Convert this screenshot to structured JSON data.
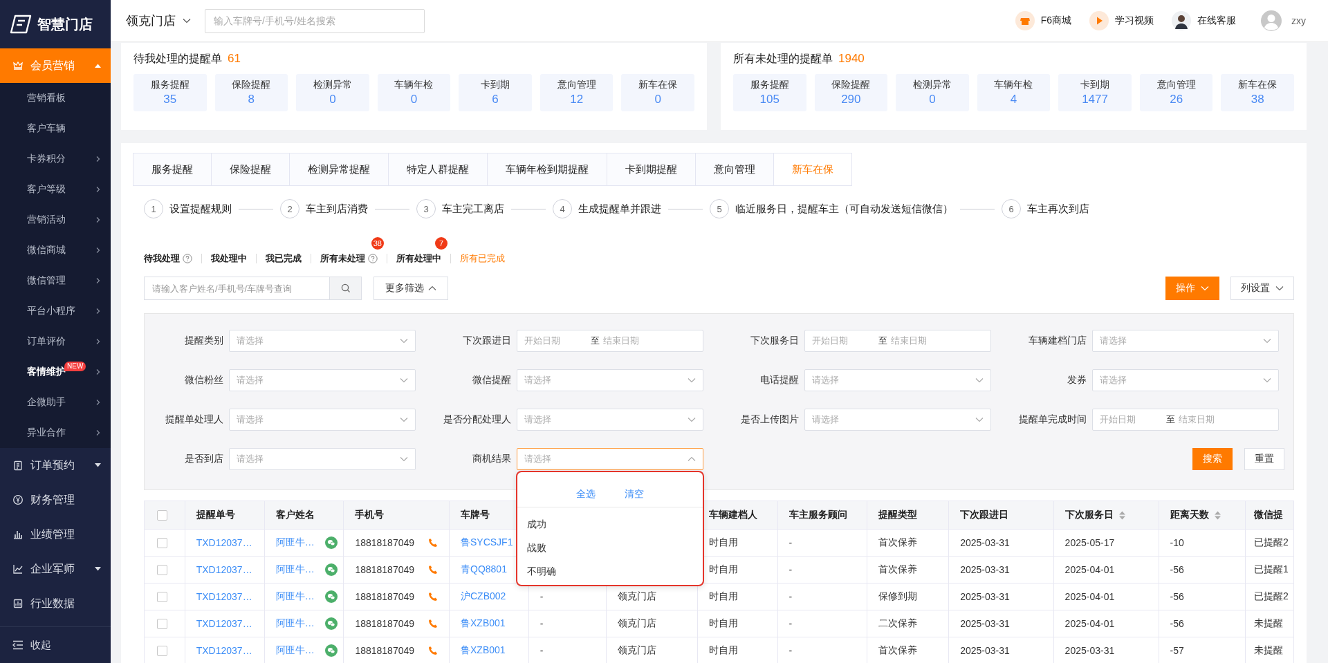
{
  "sidebar": {
    "logo": "智慧门店",
    "collapse": "收起",
    "groups": [
      {
        "label": "会员营销",
        "kind": "submenu",
        "expanded": true,
        "selected": true,
        "items": [
          {
            "label": "营销看板",
            "kind": "link",
            "selected": false
          },
          {
            "label": "客户车辆",
            "kind": "link",
            "selected": false
          },
          {
            "label": "卡券积分",
            "kind": "submenu",
            "selected": false
          },
          {
            "label": "客户等级",
            "kind": "submenu",
            "selected": false
          },
          {
            "label": "营销活动",
            "kind": "submenu",
            "selected": false
          },
          {
            "label": "微信商城",
            "kind": "submenu",
            "selected": false
          },
          {
            "label": "微信管理",
            "kind": "submenu",
            "selected": false
          },
          {
            "label": "平台小程序",
            "kind": "submenu",
            "selected": false
          },
          {
            "label": "订单评价",
            "kind": "submenu",
            "selected": false
          },
          {
            "label": "客情维护",
            "kind": "submenu",
            "selected": true,
            "badge": "NEW"
          },
          {
            "label": "企微助手",
            "kind": "submenu",
            "selected": false
          },
          {
            "label": "异业合作",
            "kind": "submenu",
            "selected": false
          }
        ]
      },
      {
        "label": "订单预约",
        "kind": "submenu",
        "expanded": false,
        "selected": false
      },
      {
        "label": "财务管理",
        "kind": "link",
        "selected": false
      },
      {
        "label": "业绩管理",
        "kind": "link",
        "selected": false
      },
      {
        "label": "企业军师",
        "kind": "submenu",
        "expanded": false,
        "selected": false
      },
      {
        "label": "行业数据",
        "kind": "link",
        "selected": false
      }
    ]
  },
  "header": {
    "store": "领克门店",
    "search_placeholder": "输入车牌号/手机号/姓名搜索",
    "user": "zxy",
    "links": [
      {
        "label": "F6商城",
        "kind": "shop"
      },
      {
        "label": "学习视频",
        "kind": "video"
      },
      {
        "label": "在线客服",
        "kind": "service"
      }
    ]
  },
  "stat_panels": [
    {
      "title": "待我处理的提醒单",
      "count": "61",
      "items": [
        {
          "label": "服务提醒",
          "value": "35"
        },
        {
          "label": "保险提醒",
          "value": "8"
        },
        {
          "label": "检测异常",
          "value": "0"
        },
        {
          "label": "车辆年检",
          "value": "0"
        },
        {
          "label": "卡到期",
          "value": "6"
        },
        {
          "label": "意向管理",
          "value": "12"
        },
        {
          "label": "新车在保",
          "value": "0"
        }
      ]
    },
    {
      "title": "所有未处理的提醒单",
      "count": "1940",
      "items": [
        {
          "label": "服务提醒",
          "value": "105"
        },
        {
          "label": "保险提醒",
          "value": "290"
        },
        {
          "label": "检测异常",
          "value": "0"
        },
        {
          "label": "车辆年检",
          "value": "4"
        },
        {
          "label": "卡到期",
          "value": "1477"
        },
        {
          "label": "意向管理",
          "value": "26"
        },
        {
          "label": "新车在保",
          "value": "38"
        }
      ]
    }
  ],
  "tabs": [
    {
      "label": "服务提醒",
      "selected": false
    },
    {
      "label": "保险提醒",
      "selected": false
    },
    {
      "label": "检测异常提醒",
      "selected": false
    },
    {
      "label": "特定人群提醒",
      "selected": false
    },
    {
      "label": "车辆年检到期提醒",
      "selected": false
    },
    {
      "label": "卡到期提醒",
      "selected": false
    },
    {
      "label": "意向管理",
      "selected": false
    },
    {
      "label": "新车在保",
      "selected": true
    }
  ],
  "steps": [
    {
      "number": "1",
      "label": "设置提醒规则"
    },
    {
      "number": "2",
      "label": "车主到店消费"
    },
    {
      "number": "3",
      "label": "车主完工离店"
    },
    {
      "number": "4",
      "label": "生成提醒单并跟进"
    },
    {
      "number": "5",
      "label": "临近服务日，提醒车主（可自动发送短信微信）"
    },
    {
      "number": "6",
      "label": "车主再次到店"
    }
  ],
  "status_tabs": [
    {
      "label": "待我处理",
      "selected": false,
      "help": true
    },
    {
      "label": "我处理中",
      "selected": false,
      "help": false
    },
    {
      "label": "我已完成",
      "selected": false,
      "help": false
    },
    {
      "label": "所有未处理",
      "selected": false,
      "help": true,
      "badge": "38"
    },
    {
      "label": "所有处理中",
      "selected": false,
      "help": false,
      "badge": "7"
    },
    {
      "label": "所有已完成",
      "selected": true,
      "help": false
    }
  ],
  "search": {
    "placeholder": "请输入客户姓名/手机号/车牌号查询"
  },
  "more_filters": {
    "label": "更多筛选",
    "expanded": true
  },
  "actions": [
    {
      "label": "操作",
      "kind": "primary"
    },
    {
      "label": "列设置",
      "kind": "default"
    }
  ],
  "filters": [
    {
      "label": "提醒类别",
      "kind": "select",
      "placeholder": "请选择",
      "open": false
    },
    {
      "label": "下次跟进日",
      "kind": "date",
      "start": "开始日期",
      "separator": "至",
      "end": "结束日期"
    },
    {
      "label": "下次服务日",
      "kind": "date",
      "start": "开始日期",
      "separator": "至",
      "end": "结束日期"
    },
    {
      "label": "车辆建档门店",
      "kind": "select",
      "placeholder": "请选择",
      "open": false
    },
    {
      "label": "微信粉丝",
      "kind": "select",
      "placeholder": "请选择",
      "open": false
    },
    {
      "label": "微信提醒",
      "kind": "select",
      "placeholder": "请选择",
      "open": false
    },
    {
      "label": "电话提醒",
      "kind": "select",
      "placeholder": "请选择",
      "open": false
    },
    {
      "label": "发券",
      "kind": "select",
      "placeholder": "请选择",
      "open": false
    },
    {
      "label": "提醒单处理人",
      "kind": "select",
      "placeholder": "请选择",
      "open": false
    },
    {
      "label": "是否分配处理人",
      "kind": "select",
      "placeholder": "请选择",
      "open": false
    },
    {
      "label": "是否上传图片",
      "kind": "select",
      "placeholder": "请选择",
      "open": false
    },
    {
      "label": "提醒单完成时间",
      "kind": "date",
      "start": "开始日期",
      "separator": "至",
      "end": "结束日期"
    },
    {
      "label": "是否到店",
      "kind": "select",
      "placeholder": "请选择",
      "open": false
    },
    {
      "label": "商机结果",
      "kind": "select",
      "placeholder": "请选择",
      "open": true,
      "menu": {
        "actions": [
          "全选",
          "清空"
        ],
        "options": [
          "成功",
          "战败",
          "不明确"
        ]
      }
    }
  ],
  "filter_buttons": [
    {
      "label": "搜索",
      "kind": "primary"
    },
    {
      "label": "重置",
      "kind": "default"
    }
  ],
  "table": {
    "select_all": {
      "checked": false
    },
    "columns": [
      {
        "label": "提醒单号",
        "kind": "link",
        "sortable": false
      },
      {
        "label": "客户姓名",
        "kind": "wechat-link",
        "sortable": false
      },
      {
        "label": "手机号",
        "kind": "phone",
        "sortable": false
      },
      {
        "label": "车牌号",
        "kind": "link",
        "sortable": false
      },
      {
        "kind": "text"
      },
      {
        "kind": "text"
      },
      {
        "label": "车辆建档人",
        "kind": "text",
        "sortable": false
      },
      {
        "label": "车主服务顾问",
        "kind": "text",
        "sortable": false
      },
      {
        "label": "提醒类型",
        "kind": "text",
        "sortable": false
      },
      {
        "label": "下次跟进日",
        "kind": "text",
        "sortable": false
      },
      {
        "label": "下次服务日",
        "kind": "text",
        "sortable": true
      },
      {
        "label": "距离天数",
        "kind": "text",
        "sortable": true
      },
      {
        "label": "微信提",
        "kind": "text",
        "sortable": false
      }
    ],
    "rows": [
      {
        "checked": false,
        "cells": [
          "TXD12037…",
          "阿匪牛…",
          "18818187049",
          "鲁SYCSJF1",
          null,
          null,
          "时自用",
          "-",
          "首次保养",
          "2025-03-31",
          "2025-05-17",
          "-10",
          "已提醒2"
        ]
      },
      {
        "checked": false,
        "cells": [
          "TXD12037…",
          "阿匪牛…",
          "18818187049",
          "青QQ8801",
          null,
          null,
          "时自用",
          "-",
          "首次保养",
          "2025-03-31",
          "2025-04-01",
          "-56",
          "已提醒1"
        ]
      },
      {
        "checked": false,
        "cells": [
          "TXD12037…",
          "阿匪牛…",
          "18818187049",
          "沪CZB002",
          "-",
          "领克门店",
          "时自用",
          "-",
          "保修到期",
          "2025-03-31",
          "2025-04-01",
          "-56",
          "已提醒2"
        ]
      },
      {
        "checked": false,
        "cells": [
          "TXD12037…",
          "阿匪牛…",
          "18818187049",
          "鲁XZB001",
          "-",
          "领克门店",
          "时自用",
          "-",
          "二次保养",
          "2025-03-31",
          "2025-04-01",
          "-56",
          "未提醒"
        ]
      },
      {
        "checked": false,
        "cells": [
          "TXD12037…",
          "阿匪牛…",
          "18818187049",
          "鲁XZB001",
          "-",
          "领克门店",
          "时自用",
          "-",
          "首次保养",
          "2025-03-31",
          "2025-03-31",
          "-57",
          "未提醒"
        ]
      }
    ]
  }
}
